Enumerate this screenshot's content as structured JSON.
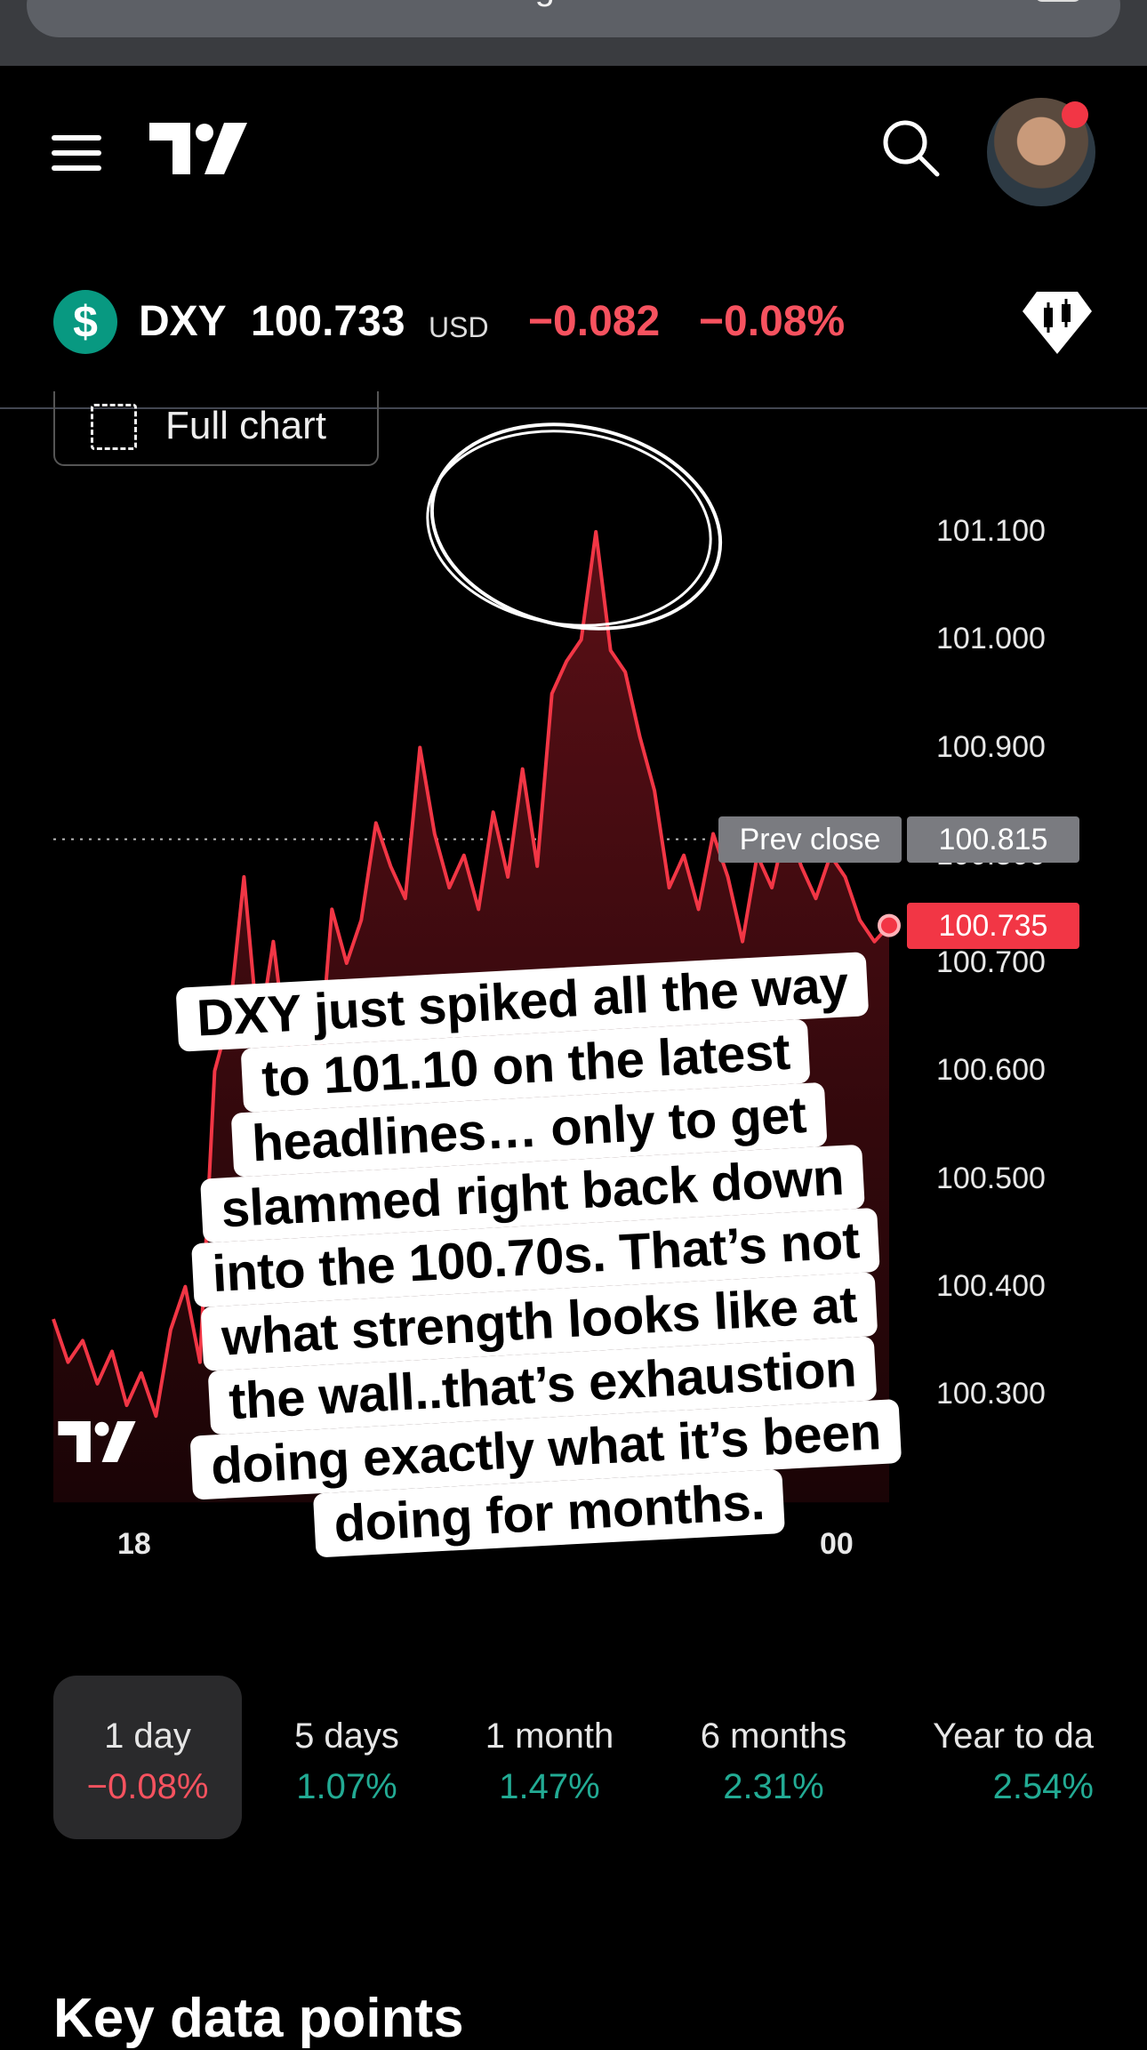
{
  "browser": {
    "url": "tradingview.com"
  },
  "ticker": {
    "symbol": "DXY",
    "icon_glyph": "$",
    "price": "100.733",
    "currency": "USD",
    "change": "−0.082",
    "change_percent": "−0.08%"
  },
  "chart": {
    "full_chart_label": "Full chart",
    "prev_close_label": "Prev close",
    "prev_close_value": "100.815",
    "last_value": "100.735",
    "x_labels": [
      "18",
      "00"
    ]
  },
  "chart_data": {
    "type": "area",
    "title": "",
    "xlabel": "",
    "ylabel": "",
    "y_tick_labels": [
      "101.100",
      "101.000",
      "100.900",
      "100.800",
      "100.700",
      "100.600",
      "100.500",
      "100.400",
      "100.300"
    ],
    "ylim": [
      100.2,
      101.15
    ],
    "x_tick_labels": [
      "18",
      "00"
    ],
    "prev_close": 100.815,
    "last": 100.735,
    "high": 101.1,
    "color": "#f23645",
    "series": [
      {
        "values": [
          100.37,
          100.33,
          100.35,
          100.31,
          100.34,
          100.29,
          100.32,
          100.28,
          100.36,
          100.4,
          100.33,
          100.6,
          100.65,
          100.78,
          100.63,
          100.72,
          100.61,
          100.66,
          100.58,
          100.75,
          100.7,
          100.74,
          100.83,
          100.79,
          100.76,
          100.9,
          100.82,
          100.77,
          100.8,
          100.75,
          100.84,
          100.78,
          100.88,
          100.79,
          100.95,
          100.98,
          101.0,
          101.1,
          100.99,
          100.97,
          100.91,
          100.86,
          100.77,
          100.8,
          100.75,
          100.82,
          100.78,
          100.72,
          100.8,
          100.77,
          100.83,
          100.79,
          100.76,
          100.8,
          100.78,
          100.74,
          100.72,
          100.735
        ]
      }
    ]
  },
  "caption_lines": [
    "DXY just spiked all the way",
    "to 101.10 on the latest",
    "headlines… only to get",
    "slammed right back down",
    "into the 100.70s. That’s not",
    "what strength looks like at",
    "the wall..that’s exhaustion",
    "doing exactly what it’s been",
    "doing for months."
  ],
  "ranges": [
    {
      "label": "1 day",
      "value": "−0.08%",
      "color": "#f7525f"
    },
    {
      "label": "5 days",
      "value": "1.07%",
      "color": "#22ab94"
    },
    {
      "label": "1 month",
      "value": "1.47%",
      "color": "#22ab94"
    },
    {
      "label": "6 months",
      "value": "2.31%",
      "color": "#22ab94"
    },
    {
      "label": "Year to da",
      "value": "2.54%",
      "color": "#22ab94"
    }
  ],
  "key_data": {
    "title": "Key data points"
  }
}
